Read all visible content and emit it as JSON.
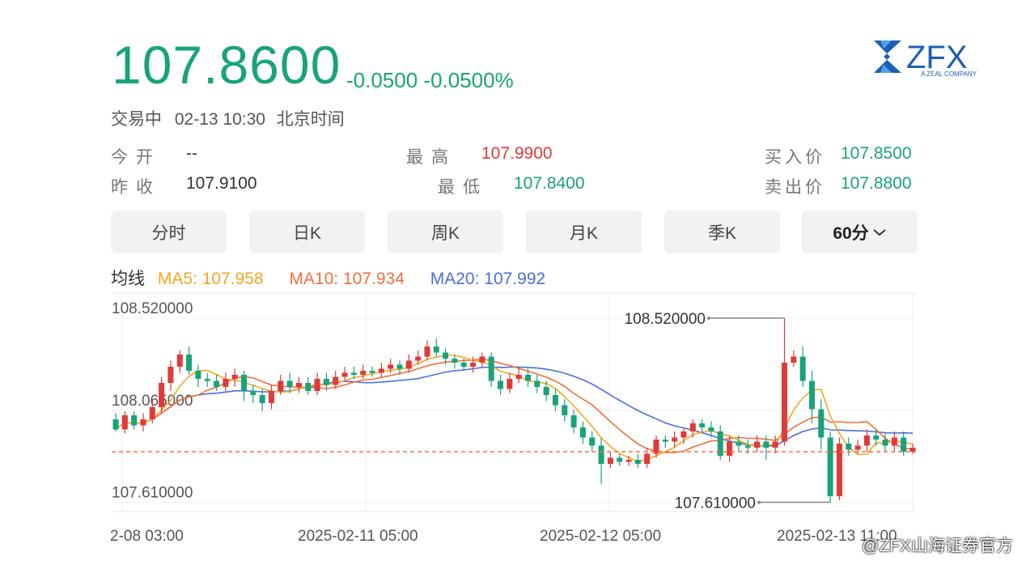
{
  "quote": {
    "price": "107.8600",
    "change": "-0.0500 -0.0500%",
    "status": "交易中",
    "datetime": "02-13 10:30",
    "timezone": "北京时间"
  },
  "stats": {
    "open_label": "今开",
    "open_value": "--",
    "prev_close_label": "昨收",
    "prev_close_value": "107.9100",
    "high_label": "最高",
    "high_value": "107.9900",
    "low_label": "最低",
    "low_value": "107.8400",
    "bid_label": "买入价",
    "bid_value": "107.8500",
    "ask_label": "卖出价",
    "ask_value": "107.8800"
  },
  "tabs": [
    {
      "label": "分时"
    },
    {
      "label": "日K"
    },
    {
      "label": "周K"
    },
    {
      "label": "月K"
    },
    {
      "label": "季K"
    },
    {
      "label": "60分"
    }
  ],
  "ma": {
    "title": "均线",
    "ma5": "MA5: 107.958",
    "ma10": "MA10: 107.934",
    "ma20": "MA20: 107.992"
  },
  "logo": {
    "text": "ZFX",
    "subtext": "A ZEAL COMPANY"
  },
  "watermark": "@ZFX山海证券官方",
  "colors": {
    "up": "#e03a3a",
    "down": "#19a37a",
    "ma5": "#f5a623",
    "ma10": "#f0703a",
    "ma20": "#4a6fd8",
    "last": "#f0703a"
  },
  "chart_data": {
    "type": "candlestick",
    "ylim": [
      107.5,
      108.62
    ],
    "y_ticks": [
      "108.520000",
      "108.065000",
      "107.610000"
    ],
    "x_ticks": [
      "2-08 03:00",
      "2025-02-11 05:00",
      "2025-02-12 05:00",
      "2025-02-13 11:00"
    ],
    "max_label": "108.520000",
    "min_label": "107.610000",
    "last_price": 107.86,
    "candles": [
      [
        108.02,
        107.97,
        108.05,
        107.96
      ],
      [
        107.97,
        108.04,
        108.06,
        107.95
      ],
      [
        108.04,
        107.99,
        108.06,
        107.97
      ],
      [
        107.99,
        108.02,
        108.05,
        107.96
      ],
      [
        108.02,
        108.08,
        108.12,
        108.0
      ],
      [
        108.08,
        108.2,
        108.23,
        108.05
      ],
      [
        108.2,
        108.28,
        108.31,
        108.16
      ],
      [
        108.28,
        108.34,
        108.36,
        108.25
      ],
      [
        108.34,
        108.26,
        108.38,
        108.24
      ],
      [
        108.26,
        108.22,
        108.29,
        108.18
      ],
      [
        108.22,
        108.21,
        108.25,
        108.18
      ],
      [
        108.21,
        108.18,
        108.24,
        108.16
      ],
      [
        108.18,
        108.22,
        108.25,
        108.16
      ],
      [
        108.22,
        108.24,
        108.27,
        108.18
      ],
      [
        108.24,
        108.16,
        108.26,
        108.11
      ],
      [
        108.16,
        108.14,
        108.19,
        108.1
      ],
      [
        108.14,
        108.1,
        108.17,
        108.06
      ],
      [
        108.1,
        108.16,
        108.19,
        108.07
      ],
      [
        108.16,
        108.21,
        108.24,
        108.14
      ],
      [
        108.21,
        108.18,
        108.25,
        108.15
      ],
      [
        108.18,
        108.2,
        108.23,
        108.15
      ],
      [
        108.2,
        108.16,
        108.23,
        108.14
      ],
      [
        108.16,
        108.22,
        108.25,
        108.14
      ],
      [
        108.22,
        108.19,
        108.25,
        108.16
      ],
      [
        108.19,
        108.23,
        108.26,
        108.17
      ],
      [
        108.23,
        108.25,
        108.28,
        108.21
      ],
      [
        108.25,
        108.24,
        108.28,
        108.22
      ],
      [
        108.24,
        108.26,
        108.29,
        108.22
      ],
      [
        108.26,
        108.25,
        108.28,
        108.23
      ],
      [
        108.25,
        108.27,
        108.3,
        108.23
      ],
      [
        108.27,
        108.29,
        108.32,
        108.25
      ],
      [
        108.29,
        108.27,
        108.31,
        108.24
      ],
      [
        108.27,
        108.31,
        108.34,
        108.25
      ],
      [
        108.31,
        108.33,
        108.36,
        108.29
      ],
      [
        108.33,
        108.38,
        108.41,
        108.31
      ],
      [
        108.38,
        108.35,
        108.42,
        108.33
      ],
      [
        108.35,
        108.32,
        108.37,
        108.29
      ],
      [
        108.32,
        108.3,
        108.34,
        108.27
      ],
      [
        108.3,
        108.28,
        108.32,
        108.26
      ],
      [
        108.28,
        108.3,
        108.33,
        108.25
      ],
      [
        108.3,
        108.33,
        108.35,
        108.28
      ],
      [
        108.33,
        108.21,
        108.35,
        108.18
      ],
      [
        108.21,
        108.17,
        108.24,
        108.14
      ],
      [
        108.17,
        108.22,
        108.25,
        108.15
      ],
      [
        108.22,
        108.24,
        108.27,
        108.2
      ],
      [
        108.24,
        108.21,
        108.27,
        108.18
      ],
      [
        108.21,
        108.18,
        108.24,
        108.15
      ],
      [
        108.18,
        108.14,
        108.21,
        108.11
      ],
      [
        108.14,
        108.09,
        108.17,
        108.06
      ],
      [
        108.09,
        108.04,
        108.12,
        108.01
      ],
      [
        108.04,
        107.98,
        108.07,
        107.95
      ],
      [
        107.98,
        107.93,
        108.01,
        107.9
      ],
      [
        107.93,
        107.89,
        107.96,
        107.86
      ],
      [
        107.89,
        107.8,
        107.93,
        107.7
      ],
      [
        107.8,
        107.83,
        107.86,
        107.78
      ],
      [
        107.83,
        107.81,
        107.85,
        107.79
      ],
      [
        107.81,
        107.82,
        107.84,
        107.79
      ],
      [
        107.82,
        107.8,
        107.85,
        107.78
      ],
      [
        107.8,
        107.85,
        107.88,
        107.78
      ],
      [
        107.85,
        107.92,
        107.94,
        107.83
      ],
      [
        107.92,
        107.91,
        107.94,
        107.88
      ],
      [
        107.91,
        107.93,
        107.96,
        107.88
      ],
      [
        107.93,
        107.96,
        107.98,
        107.9
      ],
      [
        107.96,
        108.0,
        108.02,
        107.93
      ],
      [
        108.0,
        107.98,
        108.02,
        107.95
      ],
      [
        107.98,
        107.96,
        108.01,
        107.93
      ],
      [
        107.96,
        107.84,
        107.99,
        107.82
      ],
      [
        107.84,
        107.91,
        107.94,
        107.81
      ],
      [
        107.91,
        107.89,
        107.94,
        107.86
      ],
      [
        107.89,
        107.88,
        107.92,
        107.85
      ],
      [
        107.88,
        107.91,
        107.94,
        107.86
      ],
      [
        107.91,
        107.88,
        107.94,
        107.82
      ],
      [
        107.88,
        107.91,
        107.94,
        107.85
      ],
      [
        107.91,
        108.3,
        108.52,
        107.89
      ],
      [
        108.3,
        108.33,
        108.36,
        108.28
      ],
      [
        108.33,
        108.21,
        108.38,
        108.18
      ],
      [
        108.21,
        108.07,
        108.26,
        108.0
      ],
      [
        108.07,
        107.93,
        108.12,
        107.87
      ],
      [
        107.93,
        107.64,
        107.96,
        107.61
      ],
      [
        107.64,
        107.9,
        107.93,
        107.62
      ],
      [
        107.9,
        107.87,
        107.93,
        107.84
      ],
      [
        107.87,
        107.89,
        107.92,
        107.85
      ],
      [
        107.89,
        107.94,
        107.97,
        107.86
      ],
      [
        107.94,
        107.92,
        107.97,
        107.89
      ],
      [
        107.92,
        107.89,
        107.95,
        107.86
      ],
      [
        107.89,
        107.93,
        107.96,
        107.86
      ],
      [
        107.93,
        107.86,
        107.96,
        107.84
      ],
      [
        107.86,
        107.88,
        107.9,
        107.85
      ]
    ]
  }
}
